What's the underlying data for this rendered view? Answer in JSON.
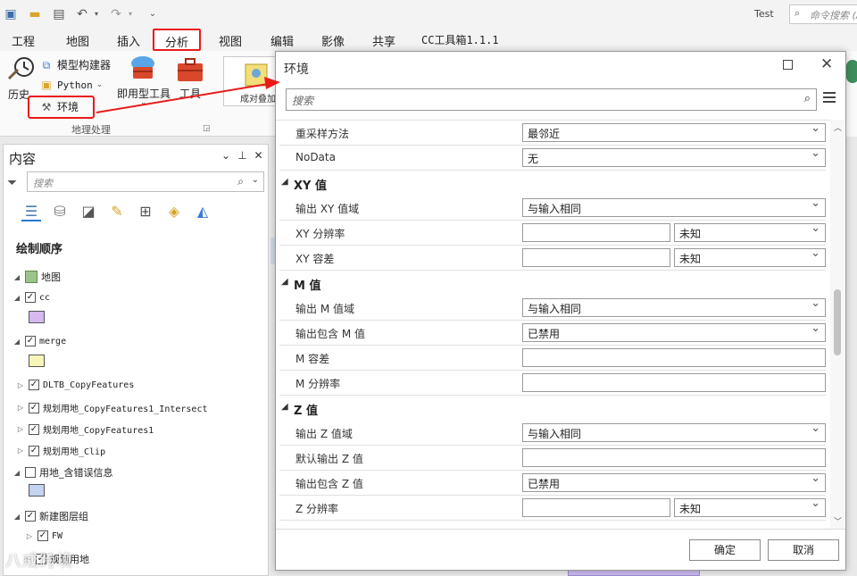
{
  "app": {
    "user": "Test",
    "command_search_placeholder": "命令搜索 (Alt+Q)"
  },
  "tabs": [
    "工程",
    "地图",
    "插入",
    "分析",
    "视图",
    "编辑",
    "影像",
    "共享",
    "CC工具箱1.1.1"
  ],
  "active_tab": "分析",
  "ribbon": {
    "history": "历史",
    "model_builder": "模型构建器",
    "python": "Python",
    "environments": "环境",
    "ready_to_use": "即用型工具",
    "tools": "工具",
    "group": "地理处理",
    "gallery_item": "成对叠加"
  },
  "contents": {
    "title": "内容",
    "search_placeholder": "搜索",
    "drawing_order": "绘制顺序",
    "layers": [
      {
        "name": "地图",
        "expand": "expanded",
        "checkbox": false,
        "mono": false
      },
      {
        "name": "cc",
        "expand": "expanded",
        "checkbox": true,
        "checked": true,
        "mono": true,
        "swatch": "#d5b9ef"
      },
      {
        "name": "merge",
        "expand": "expanded",
        "checkbox": true,
        "checked": true,
        "mono": true,
        "swatch": "#f7f5b8"
      },
      {
        "name": "DLTB_CopyFeatures",
        "expand": "collapsed",
        "checkbox": true,
        "checked": true,
        "mono": true
      },
      {
        "name": "规划用地_CopyFeatures1_Intersect",
        "expand": "collapsed",
        "checkbox": true,
        "checked": true,
        "mono": true
      },
      {
        "name": "规划用地_CopyFeatures1",
        "expand": "collapsed",
        "checkbox": true,
        "checked": true,
        "mono": true
      },
      {
        "name": "规划用地_Clip",
        "expand": "collapsed",
        "checkbox": true,
        "checked": true,
        "mono": true
      },
      {
        "name": "用地_含错误信息",
        "expand": "expanded",
        "checkbox": true,
        "checked": false,
        "mono": false,
        "swatch": "#c3d3f0"
      },
      {
        "name": "新建图层组",
        "expand": "expanded",
        "checkbox": true,
        "checked": true,
        "mono": false
      },
      {
        "name": "FW",
        "expand": "collapsed",
        "checkbox": true,
        "checked": true,
        "mono": true
      },
      {
        "name": "规划用地",
        "expand": "collapsed",
        "checkbox": true,
        "checked": true,
        "mono": false
      }
    ]
  },
  "dialog": {
    "title": "环境",
    "search_placeholder": "搜索",
    "rows": [
      {
        "type": "param",
        "label": "重采样方法",
        "value": "最邻近",
        "kind": "select"
      },
      {
        "type": "param",
        "label": "NoData",
        "value": "无",
        "kind": "select"
      },
      {
        "type": "section",
        "label": "XY 值"
      },
      {
        "type": "param",
        "label": "输出 XY 值域",
        "value": "与输入相同",
        "kind": "select"
      },
      {
        "type": "param",
        "label": "XY 分辨率",
        "value": "",
        "unit": "未知",
        "kind": "split"
      },
      {
        "type": "param",
        "label": "XY 容差",
        "value": "",
        "unit": "未知",
        "kind": "split"
      },
      {
        "type": "section",
        "label": "M 值"
      },
      {
        "type": "param",
        "label": "输出 M 值域",
        "value": "与输入相同",
        "kind": "select"
      },
      {
        "type": "param",
        "label": "输出包含 M 值",
        "value": "已禁用",
        "kind": "select"
      },
      {
        "type": "param",
        "label": "M 容差",
        "value": "",
        "kind": "text"
      },
      {
        "type": "param",
        "label": "M 分辨率",
        "value": "",
        "kind": "text"
      },
      {
        "type": "section",
        "label": "Z 值"
      },
      {
        "type": "param",
        "label": "输出 Z 值域",
        "value": "与输入相同",
        "kind": "select"
      },
      {
        "type": "param",
        "label": "默认输出 Z 值",
        "value": "",
        "kind": "text"
      },
      {
        "type": "param",
        "label": "输出包含 Z 值",
        "value": "已禁用",
        "kind": "select"
      },
      {
        "type": "param",
        "label": "Z 分辨率",
        "value": "",
        "unit": "未知",
        "kind": "split"
      }
    ],
    "ok": "确定",
    "cancel": "取消"
  },
  "watermark": "八戒跨境",
  "colors": {
    "highlight": "#e81b1b",
    "accent": "#2b78c9"
  }
}
